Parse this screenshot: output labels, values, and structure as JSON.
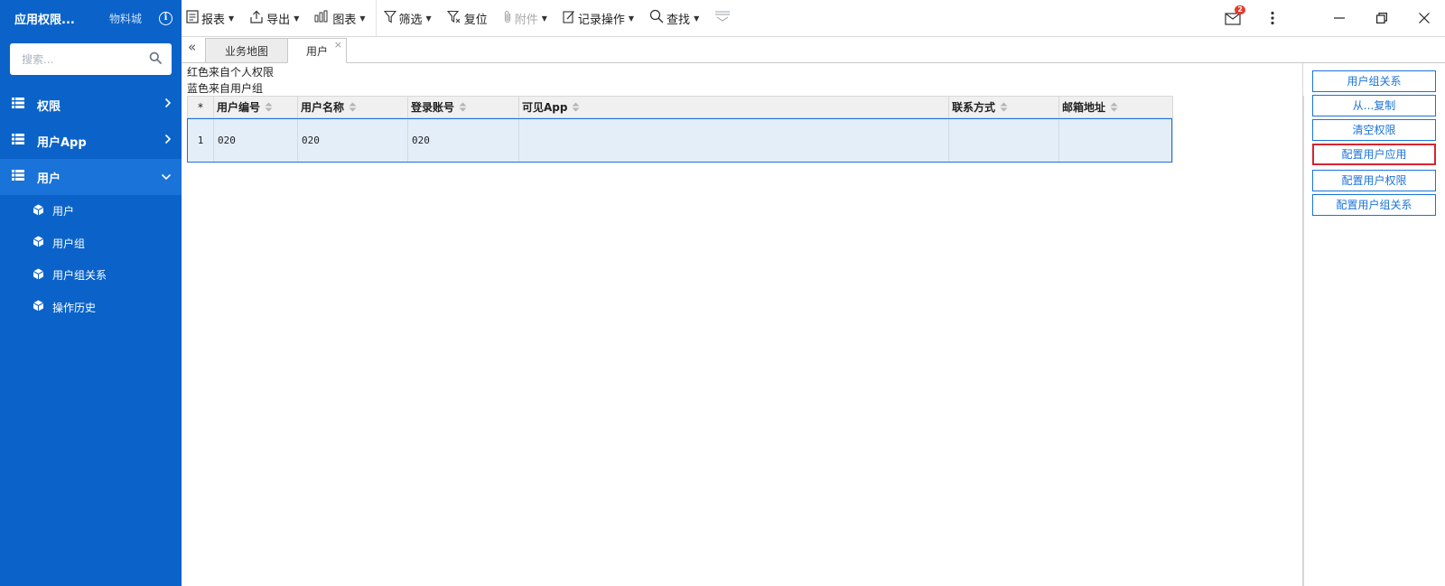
{
  "sidebar": {
    "app_title": "应用权限...",
    "app_subtitle": "物料城",
    "info_icon": "i",
    "search_placeholder": "搜索...",
    "menu": [
      {
        "label": "权限",
        "icon": "list-icon",
        "state": "collapsed"
      },
      {
        "label": "用户App",
        "icon": "list-icon",
        "state": "collapsed"
      },
      {
        "label": "用户",
        "icon": "list-icon",
        "state": "expanded"
      }
    ],
    "submenu": [
      {
        "label": "用户",
        "icon": "cube-icon"
      },
      {
        "label": "用户组",
        "icon": "cube-icon"
      },
      {
        "label": "用户组关系",
        "icon": "cube-icon"
      },
      {
        "label": "操作历史",
        "icon": "cube-icon"
      }
    ]
  },
  "toolbar": {
    "report": "报表",
    "export": "导出",
    "chart": "图表",
    "filter": "筛选",
    "reset": "复位",
    "attachment": "附件",
    "record_ops": "记录操作",
    "find": "查找",
    "notification_count": "2"
  },
  "tabs": [
    {
      "label": "业务地图",
      "active": false
    },
    {
      "label": "用户",
      "active": true,
      "close": "×"
    }
  ],
  "collapse_icon": "«",
  "legend": {
    "line1": "红色来自个人权限",
    "line2": "蓝色来自用户组"
  },
  "table": {
    "star_header": "*",
    "columns": [
      "用户编号",
      "用户名称",
      "登录账号",
      "可见App",
      "联系方式",
      "邮箱地址"
    ],
    "rows": [
      {
        "index": "1",
        "cells": [
          "020",
          "020",
          "020",
          "",
          "",
          ""
        ]
      }
    ]
  },
  "actions": [
    {
      "label": "用户组关系",
      "focused": false
    },
    {
      "label": "从...复制",
      "focused": false
    },
    {
      "label": "清空权限",
      "focused": false
    },
    {
      "label": "配置用户应用",
      "focused": true
    },
    {
      "label": "配置用户权限",
      "focused": false
    },
    {
      "label": "配置用户组关系",
      "focused": false
    }
  ],
  "colors": {
    "sidebar_bg": "#0b63c9",
    "sidebar_active": "#1a73d9",
    "accent": "#1a73d9",
    "focus_border": "#d6242f",
    "badge": "#e23a2e"
  }
}
